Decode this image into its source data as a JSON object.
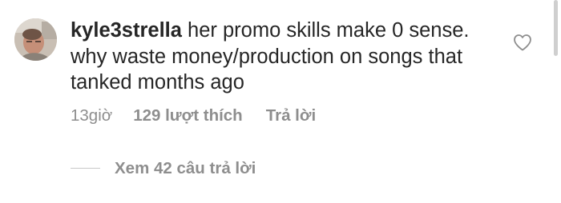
{
  "comment": {
    "username": "kyle3strella",
    "text": " her promo skills make 0 sense. why waste money/production on songs that tanked months ago"
  },
  "meta": {
    "time": "13giờ",
    "likes": "129 lượt thích",
    "reply_label": "Trả lời"
  },
  "replies": {
    "view_label": "Xem 42 câu trả lời"
  },
  "icons": {
    "avatar": "profile-photo",
    "like": "heart-outline-icon"
  },
  "colors": {
    "text": "#262626",
    "secondary": "#8e8e8e",
    "background": "#ffffff"
  }
}
